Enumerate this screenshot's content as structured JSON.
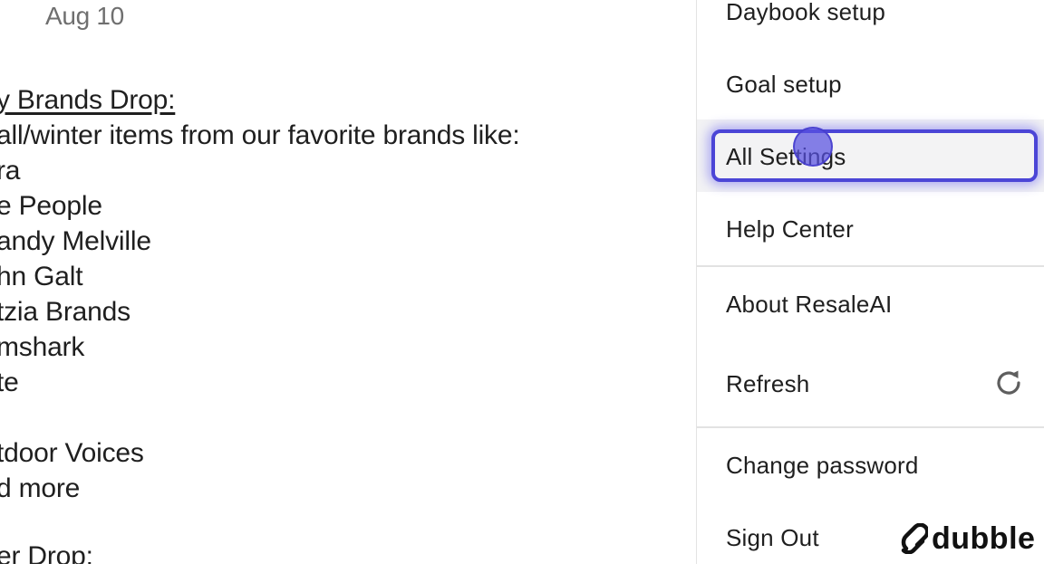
{
  "document": {
    "date": "Aug 10",
    "heading": "y Brands Drop:",
    "intro": "all/winter items from our favorite brands like:",
    "brands": [
      "ra",
      "e People",
      "andy Melville",
      "hn Galt",
      "tzia Brands",
      "mshark",
      "te",
      "",
      "tdoor Voices",
      "d more"
    ],
    "next_heading": "er Drop:"
  },
  "menu": {
    "items": [
      {
        "label": "Daybook setup"
      },
      {
        "label": "Goal setup"
      },
      {
        "label": "All Settings"
      },
      {
        "label": "Help Center"
      },
      {
        "label": "About ResaleAI"
      },
      {
        "label": "Refresh",
        "icon": "refresh-icon"
      },
      {
        "label": "Change password"
      },
      {
        "label": "Sign Out"
      }
    ],
    "focused_item": "All Settings"
  },
  "watermark": {
    "brand": "dubble",
    "icon": "dubble-logo-icon"
  },
  "colors": {
    "focus": "#4b45d6",
    "cursor": "#5850e1",
    "date": "#6f6f6f"
  }
}
